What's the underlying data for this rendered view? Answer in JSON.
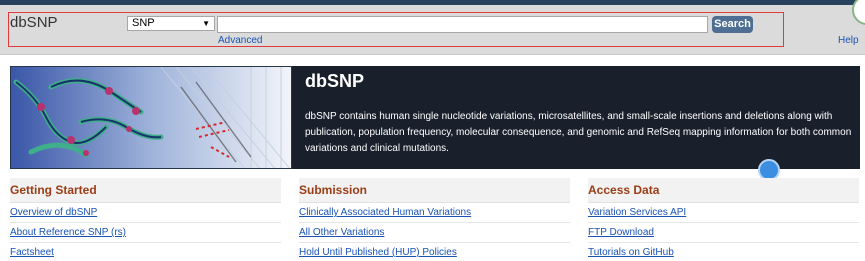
{
  "header": {
    "app_name": "dbSNP",
    "database_selected": "SNP",
    "search_value": "",
    "search_button": "Search",
    "advanced_link": "Advanced",
    "help_link": "Help"
  },
  "hero": {
    "title": "dbSNP",
    "description": "dbSNP contains human single nucleotide variations, microsatellites, and small-scale insertions and deletions along with publication, population frequency, molecular consequence, and genomic and RefSeq mapping information for both common variations and clinical mutations."
  },
  "columns": [
    {
      "heading": "Getting Started",
      "links": [
        "Overview of dbSNP",
        "About Reference SNP (rs)",
        "Factsheet"
      ]
    },
    {
      "heading": "Submission",
      "links": [
        "Clinically Associated Human Variations",
        "All Other Variations",
        "Hold Until Published (HUP) Policies"
      ]
    },
    {
      "heading": "Access Data",
      "links": [
        "Variation Services API",
        "FTP Download",
        "Tutorials on GitHub"
      ]
    }
  ],
  "colors": {
    "header_bg": "#dbdbdb",
    "search_button": "#4e6e93",
    "hero_panel": "#1a1f2c",
    "heading_text": "#9b3d16",
    "link_text": "#1a53b5"
  }
}
